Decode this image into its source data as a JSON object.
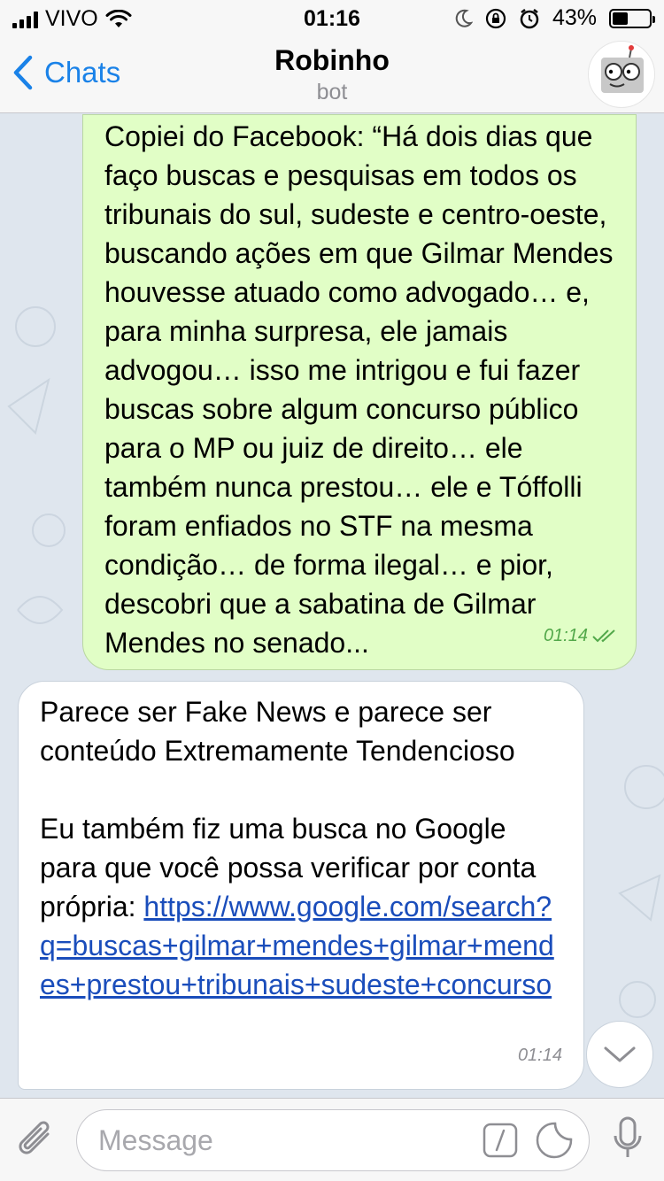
{
  "status_bar": {
    "carrier": "VIVO",
    "time": "01:16",
    "battery_percent": "43%",
    "battery_level": 0.43
  },
  "nav": {
    "back_label": "Chats",
    "title": "Robinho",
    "subtitle": "bot"
  },
  "messages": [
    {
      "direction": "outgoing",
      "text": "Copiei do Facebook: “Há dois dias que faço buscas e pesquisas em todos os tribunais do sul, sudeste e centro-oeste, buscando ações em que Gilmar Mendes houvesse atuado como advogado… e, para minha surpresa, ele jamais advogou… isso me intrigou e fui fazer buscas sobre algum concurso público para o MP ou juiz de direito… ele também nunca prestou… ele e Tóffolli foram enfiados no STF na mesma condição… de forma ilegal… e pior, descobri que a sabatina de Gilmar Mendes no senado...",
      "time": "01:14",
      "status": "read"
    },
    {
      "direction": "incoming",
      "text_p1": "Parece ser Fake News e parece ser conteúdo Extremamente Tendencioso",
      "text_p2_prefix": "Eu também fiz uma busca no Google para que você possa verificar por conta própria: ",
      "link": "https://www.google.com/search?q=buscas+gilmar+mendes+gilmar+mendes+prestou+tribunais+sudeste+concurso",
      "time": "01:14"
    }
  ],
  "input": {
    "placeholder": "Message"
  },
  "colors": {
    "accent": "#1a82e8",
    "outgoing_bubble": "#e1fec6",
    "incoming_bubble": "#ffffff",
    "chat_background": "#dfe6ee",
    "link": "#1a4dbb"
  },
  "icons": [
    "signal-icon",
    "wifi-icon",
    "moon-icon",
    "rotation-lock-icon",
    "alarm-icon",
    "battery-icon",
    "chevron-left-icon",
    "robot-avatar-icon",
    "double-check-icon",
    "chevron-down-icon",
    "paperclip-icon",
    "bot-command-icon",
    "sticker-icon",
    "microphone-icon"
  ]
}
